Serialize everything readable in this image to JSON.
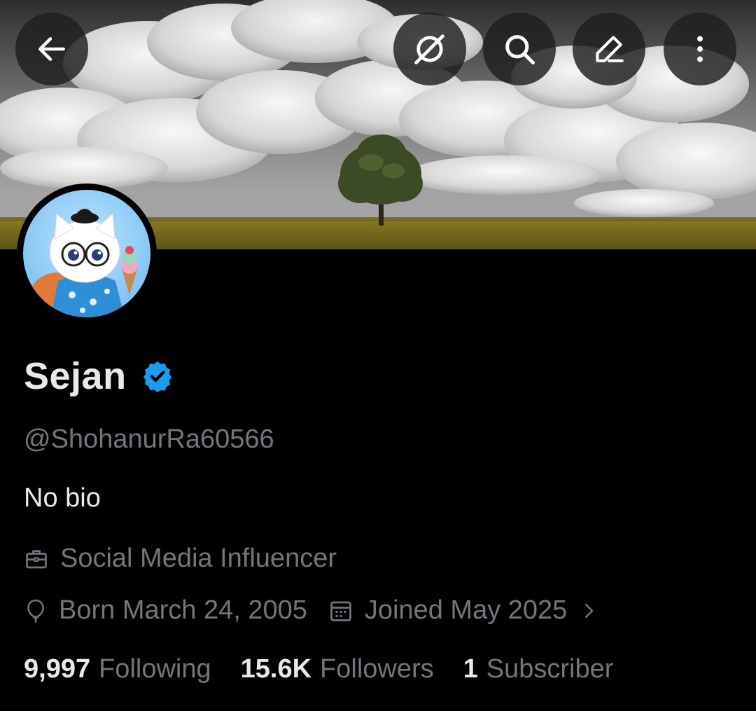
{
  "header": {
    "back_icon": "arrow-left-icon",
    "actions": [
      "grok-icon",
      "search-icon",
      "edit-icon",
      "more-vertical-icon"
    ]
  },
  "profile": {
    "display_name": "Sejan",
    "verified": true,
    "handle": "@ShohanurRa60566",
    "bio": "No bio",
    "category": "Social Media Influencer",
    "birthday": "Born March 24, 2005",
    "joined": "Joined May 2025"
  },
  "stats": {
    "following_count": "9,997",
    "following_label": "Following",
    "followers_count": "15.6K",
    "followers_label": "Followers",
    "subscriber_count": "1",
    "subscriber_label": "Subscriber"
  },
  "colors": {
    "background": "#000000",
    "primary_text": "#e7e9ea",
    "secondary_text": "#71767b",
    "verified_blue": "#1d9bf0"
  }
}
